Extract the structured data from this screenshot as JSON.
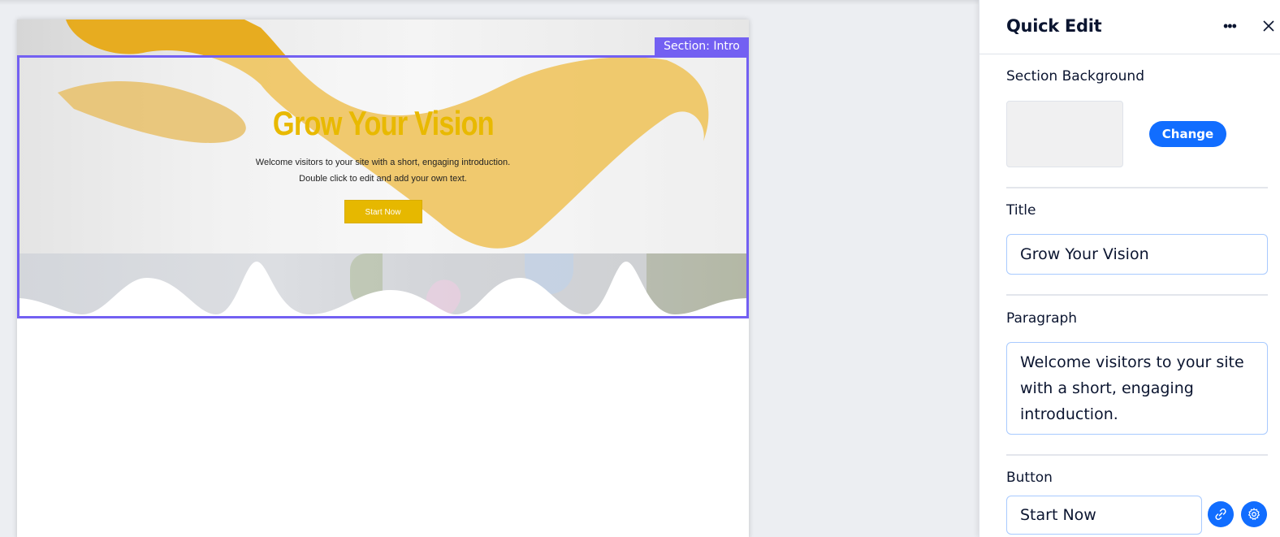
{
  "canvas": {
    "section_tag": "Section: Intro",
    "hero": {
      "title": "Grow Your Vision",
      "paragraph_line1": "Welcome visitors to your site with a short, engaging introduction.",
      "paragraph_line2": "Double click to edit and add your own text.",
      "button_label": "Start Now"
    },
    "colors": {
      "selection": "#7360f2",
      "title": "#e8b900",
      "button": "#e6b800"
    }
  },
  "panel": {
    "title": "Quick Edit",
    "more_icon": "more-horizontal-icon",
    "close_icon": "close-icon",
    "section_background_label": "Section Background",
    "change_button": "Change",
    "title_label": "Title",
    "title_value": "Grow Your Vision",
    "paragraph_label": "Paragraph",
    "paragraph_value": "Welcome visitors to your site with a short, engaging introduction.",
    "button_label": "Button",
    "button_value": "Start Now",
    "link_icon": "link-icon",
    "settings_icon": "gear-icon",
    "accent": "#116dff"
  }
}
